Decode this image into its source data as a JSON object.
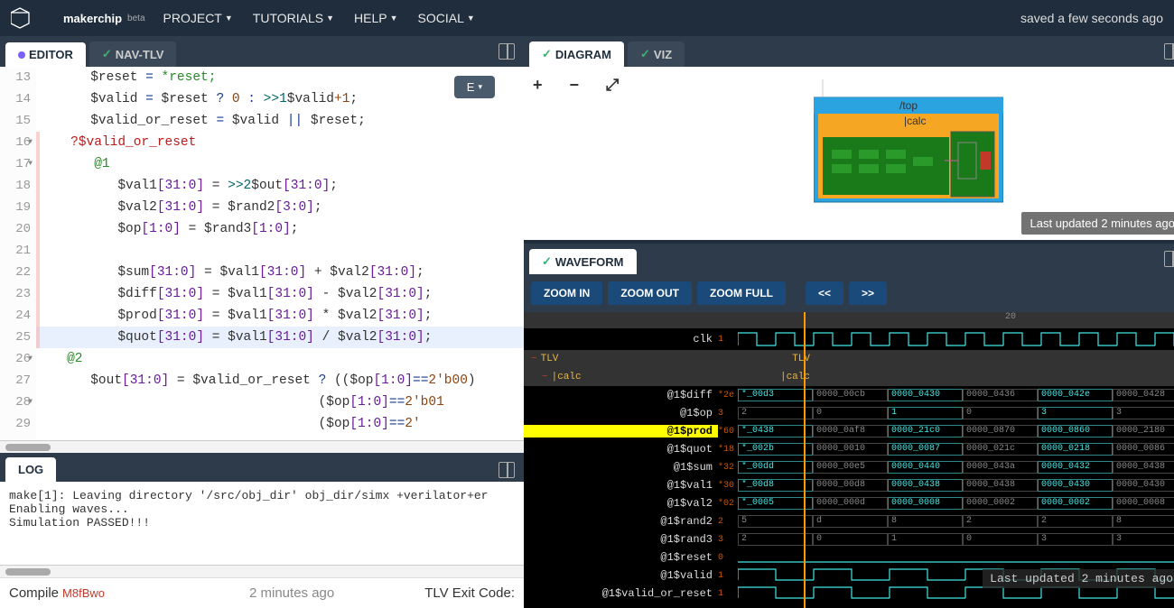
{
  "topbar": {
    "brand": "makerchip",
    "beta": "beta",
    "menu": [
      "PROJECT",
      "TUTORIALS",
      "HELP",
      "SOCIAL"
    ],
    "saved": "saved a few seconds ago"
  },
  "tabs": {
    "editor": "EDITOR",
    "navtlv": "NAV-TLV",
    "diagram": "DIAGRAM",
    "viz": "VIZ",
    "waveform": "WAVEFORM",
    "log": "LOG"
  },
  "editor": {
    "dropdown": "E",
    "lines": [
      {
        "n": "13",
        "tokens": [
          {
            "t": "      $reset ",
            "c": ""
          },
          {
            "t": "=",
            "c": "c-blue"
          },
          {
            "t": " *reset;",
            "c": "c-green"
          }
        ]
      },
      {
        "n": "14",
        "tokens": [
          {
            "t": "      $valid ",
            "c": ""
          },
          {
            "t": "=",
            "c": "c-blue"
          },
          {
            "t": " $reset ",
            "c": ""
          },
          {
            "t": "?",
            "c": "c-blue"
          },
          {
            "t": " 0 ",
            "c": "c-brown"
          },
          {
            "t": ":",
            "c": "c-blue"
          },
          {
            "t": " >>1",
            "c": "c-teal"
          },
          {
            "t": "$valid",
            "c": ""
          },
          {
            "t": "+1",
            "c": "c-brown"
          },
          {
            "t": ";",
            "c": ""
          }
        ]
      },
      {
        "n": "15",
        "tokens": [
          {
            "t": "      $valid_or_reset ",
            "c": ""
          },
          {
            "t": "=",
            "c": "c-blue"
          },
          {
            "t": " $valid ",
            "c": ""
          },
          {
            "t": "||",
            "c": "c-blue"
          },
          {
            "t": " $reset;",
            "c": ""
          }
        ]
      },
      {
        "n": "16",
        "fold": true,
        "red": true,
        "tokens": [
          {
            "t": "   ?$valid_or_reset",
            "c": "c-red"
          }
        ]
      },
      {
        "n": "17",
        "fold": true,
        "red": true,
        "tokens": [
          {
            "t": "      @1",
            "c": "c-green"
          }
        ]
      },
      {
        "n": "18",
        "red": true,
        "tokens": [
          {
            "t": "         $val1",
            "c": ""
          },
          {
            "t": "[31:0]",
            "c": "c-purple"
          },
          {
            "t": " = ",
            "c": ""
          },
          {
            "t": ">>2",
            "c": "c-teal"
          },
          {
            "t": "$out",
            "c": ""
          },
          {
            "t": "[31:0]",
            "c": "c-purple"
          },
          {
            "t": ";",
            "c": ""
          }
        ]
      },
      {
        "n": "19",
        "red": true,
        "tokens": [
          {
            "t": "         $val2",
            "c": ""
          },
          {
            "t": "[31:0]",
            "c": "c-purple"
          },
          {
            "t": " = $rand2",
            "c": ""
          },
          {
            "t": "[3:0]",
            "c": "c-purple"
          },
          {
            "t": ";",
            "c": ""
          }
        ]
      },
      {
        "n": "20",
        "red": true,
        "tokens": [
          {
            "t": "         $op",
            "c": ""
          },
          {
            "t": "[1:0]",
            "c": "c-purple"
          },
          {
            "t": " = $rand3",
            "c": ""
          },
          {
            "t": "[1:0]",
            "c": "c-purple"
          },
          {
            "t": ";",
            "c": ""
          }
        ]
      },
      {
        "n": "21",
        "red": true,
        "tokens": [
          {
            "t": " ",
            "c": ""
          }
        ]
      },
      {
        "n": "22",
        "red": true,
        "tokens": [
          {
            "t": "         $sum",
            "c": ""
          },
          {
            "t": "[31:0]",
            "c": "c-purple"
          },
          {
            "t": " = $val1",
            "c": ""
          },
          {
            "t": "[31:0]",
            "c": "c-purple"
          },
          {
            "t": " + $val2",
            "c": ""
          },
          {
            "t": "[31:0]",
            "c": "c-purple"
          },
          {
            "t": ";",
            "c": ""
          }
        ]
      },
      {
        "n": "23",
        "red": true,
        "tokens": [
          {
            "t": "         $diff",
            "c": ""
          },
          {
            "t": "[31:0]",
            "c": "c-purple"
          },
          {
            "t": " = $val1",
            "c": ""
          },
          {
            "t": "[31:0]",
            "c": "c-purple"
          },
          {
            "t": " - $val2",
            "c": ""
          },
          {
            "t": "[31:0]",
            "c": "c-purple"
          },
          {
            "t": ";",
            "c": ""
          }
        ]
      },
      {
        "n": "24",
        "red": true,
        "tokens": [
          {
            "t": "         $prod",
            "c": ""
          },
          {
            "t": "[31:0]",
            "c": "c-purple"
          },
          {
            "t": " = $val1",
            "c": ""
          },
          {
            "t": "[31:0]",
            "c": "c-purple"
          },
          {
            "t": " * $val2",
            "c": ""
          },
          {
            "t": "[31:0]",
            "c": "c-purple"
          },
          {
            "t": ";",
            "c": ""
          }
        ]
      },
      {
        "n": "25",
        "red": true,
        "hl": true,
        "tokens": [
          {
            "t": "         $quot",
            "c": ""
          },
          {
            "t": "[31:0]",
            "c": "c-purple"
          },
          {
            "t": " = $val1",
            "c": ""
          },
          {
            "t": "[31:0]",
            "c": "c-purple"
          },
          {
            "t": " / $val2",
            "c": ""
          },
          {
            "t": "[31:0]",
            "c": "c-purple"
          },
          {
            "t": ";",
            "c": ""
          }
        ]
      },
      {
        "n": "26",
        "fold": true,
        "tokens": [
          {
            "t": "   @2",
            "c": "c-green"
          }
        ]
      },
      {
        "n": "27",
        "tokens": [
          {
            "t": "      $out",
            "c": ""
          },
          {
            "t": "[31:0]",
            "c": "c-purple"
          },
          {
            "t": " = $valid_or_reset ",
            "c": ""
          },
          {
            "t": "?",
            "c": "c-blue"
          },
          {
            "t": " (($op",
            "c": ""
          },
          {
            "t": "[1:0]",
            "c": "c-purple"
          },
          {
            "t": "==",
            "c": "c-blue"
          },
          {
            "t": "2'b00",
            "c": "c-brown"
          },
          {
            "t": ")",
            "c": ""
          }
        ]
      },
      {
        "n": "28",
        "fold": true,
        "tokens": [
          {
            "t": "                                   ($op",
            "c": ""
          },
          {
            "t": "[1:0]",
            "c": "c-purple"
          },
          {
            "t": "==",
            "c": "c-blue"
          },
          {
            "t": "2'b01",
            "c": "c-brown"
          }
        ]
      },
      {
        "n": "29",
        "tokens": [
          {
            "t": "                                   ($op",
            "c": ""
          },
          {
            "t": "[1:0]",
            "c": "c-purple"
          },
          {
            "t": "==",
            "c": "c-blue"
          },
          {
            "t": "2'",
            "c": "c-brown"
          }
        ]
      }
    ]
  },
  "log": {
    "lines": [
      "make[1]: Leaving directory '/src/obj_dir' obj_dir/simx +verilator+er",
      "Enabling waves...",
      "Simulation PASSED!!!"
    ],
    "compile_label": "Compile",
    "session": "M8fBwo",
    "time": "2 minutes ago",
    "exit": "TLV Exit Code:"
  },
  "diagram": {
    "zoom_in": "+",
    "zoom_out": "−",
    "expand": "⤢",
    "top": "/top",
    "calc": "|calc",
    "updated": "Last updated 2 minutes ago"
  },
  "waveform": {
    "zoom_in": "ZOOM IN",
    "zoom_out": "ZOOM OUT",
    "zoom_full": "ZOOM FULL",
    "prev": "<<",
    "next": ">>",
    "time20": "20",
    "clk_label": "clk",
    "clk_idx": "1",
    "tlv": "TLV",
    "calc": "|calc",
    "updated": "Last updated 2 minutes ago",
    "rows": [
      {
        "label": "@1$diff",
        "idx": "*2e",
        "cells": [
          "*_00d3",
          "0000_00cb",
          "0000_0430",
          "0000_0436",
          "0000_042e",
          "0000_0428"
        ],
        "hl": [
          0,
          2,
          4
        ]
      },
      {
        "label": "@1$op",
        "idx": "3",
        "cells": [
          "2",
          "0",
          "1",
          "0",
          "3",
          "3"
        ],
        "hl": [
          2,
          4
        ]
      },
      {
        "label": "@1$prod",
        "idx": "*60",
        "cells": [
          "*_0438",
          "0000_0af8",
          "0000_21c0",
          "0000_0870",
          "0000_0860",
          "0000_2180"
        ],
        "sel": true,
        "hl": [
          0,
          2,
          4
        ]
      },
      {
        "label": "@1$quot",
        "idx": "*18",
        "cells": [
          "*_002b",
          "0000_0010",
          "0000_0087",
          "0000_021c",
          "0000_0218",
          "0000_0086"
        ],
        "hl": [
          0,
          2,
          4
        ]
      },
      {
        "label": "@1$sum",
        "idx": "*32",
        "cells": [
          "*_00dd",
          "0000_00e5",
          "0000_0440",
          "0000_043a",
          "0000_0432",
          "0000_0438"
        ],
        "hl": [
          0,
          2,
          4
        ]
      },
      {
        "label": "@1$val1",
        "idx": "*30",
        "cells": [
          "*_00d8",
          "0000_00d8",
          "0000_0438",
          "0000_0438",
          "0000_0430",
          "0000_0430"
        ],
        "hl": [
          0,
          2,
          4
        ]
      },
      {
        "label": "@1$val2",
        "idx": "*02",
        "cells": [
          "*_0005",
          "0000_000d",
          "0000_0008",
          "0000_0002",
          "0000_0002",
          "0000_0008"
        ],
        "hl": [
          0,
          2,
          4
        ]
      },
      {
        "label": "@1$rand2",
        "idx": "2",
        "cells": [
          "5",
          "d",
          "8",
          "2",
          "2",
          "8"
        ]
      },
      {
        "label": "@1$rand3",
        "idx": "3",
        "cells": [
          "2",
          "0",
          "1",
          "0",
          "3",
          "3"
        ]
      },
      {
        "label": "@1$reset",
        "idx": "0",
        "clk": "zero"
      },
      {
        "label": "@1$valid",
        "idx": "1",
        "clk": "pulse"
      },
      {
        "label": "@1$valid_or_reset",
        "idx": "1",
        "clk": "pulse"
      }
    ]
  }
}
